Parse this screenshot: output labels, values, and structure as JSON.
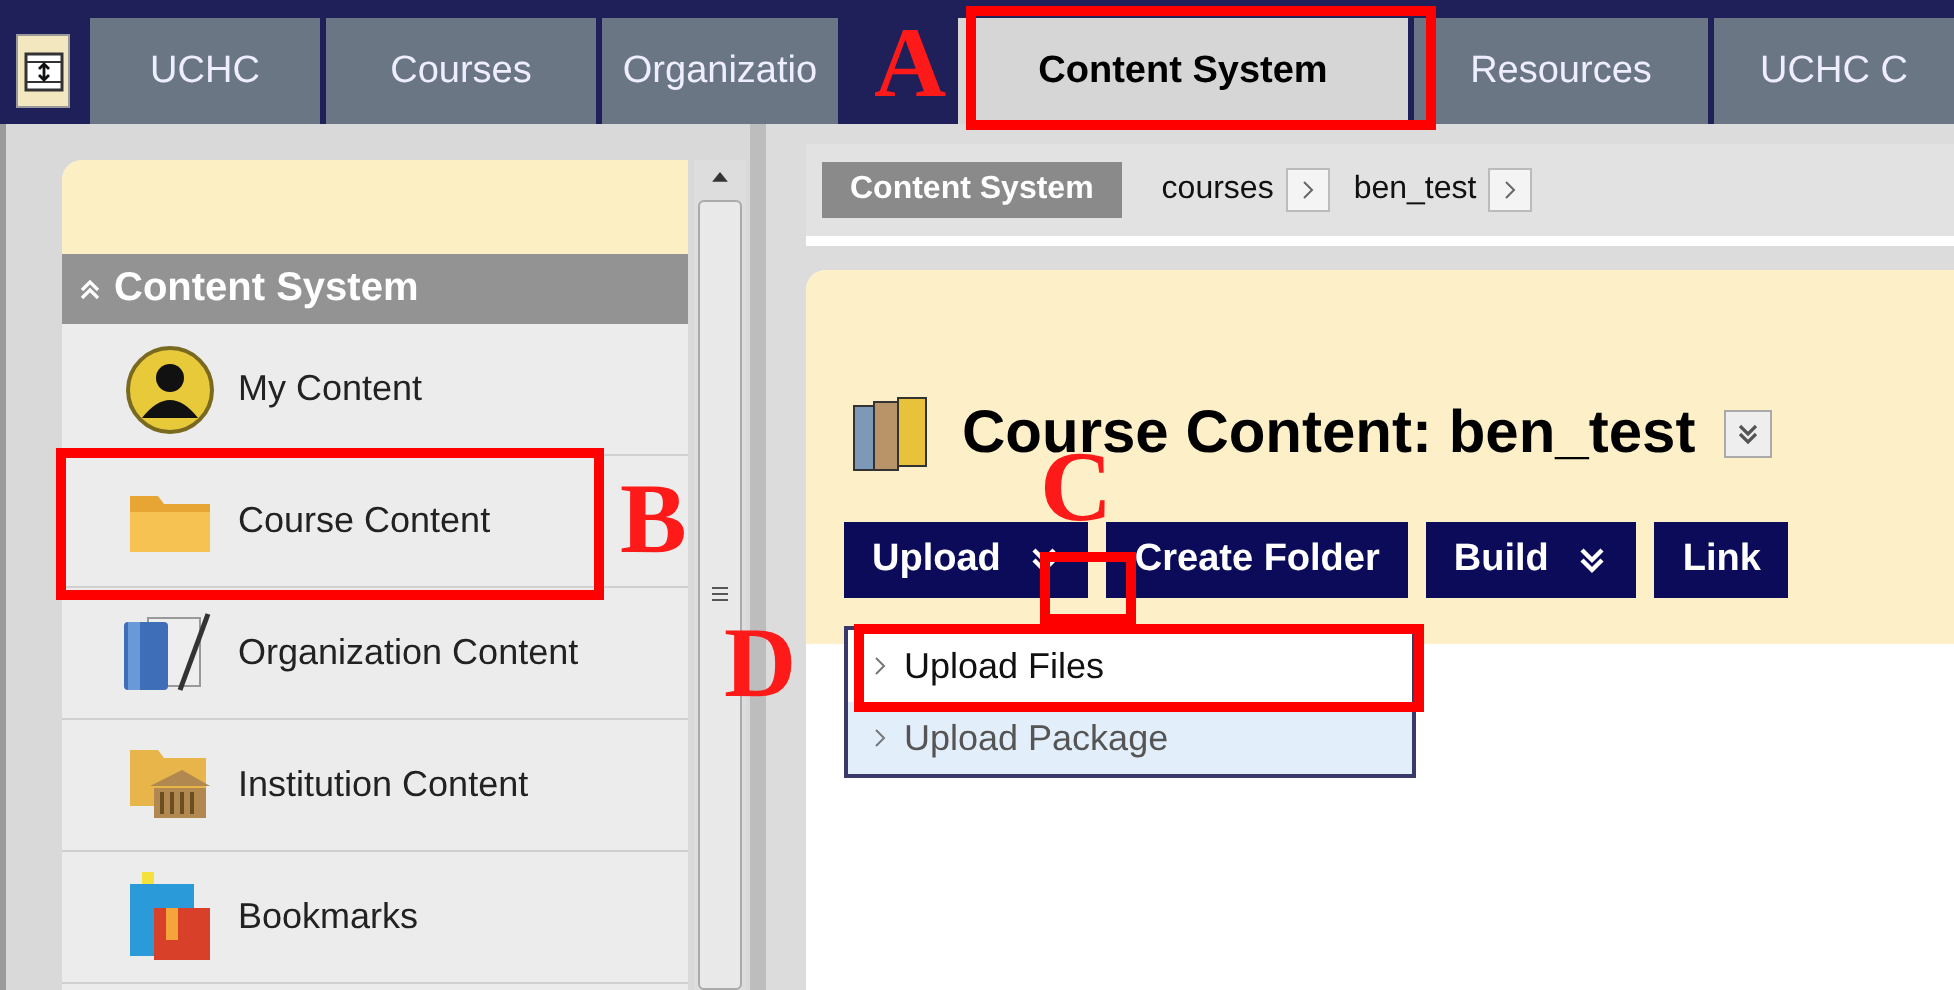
{
  "top_tabs": [
    {
      "label": "UCHC",
      "selected": false
    },
    {
      "label": "Courses",
      "selected": false
    },
    {
      "label": "Organizatio",
      "selected": false
    },
    {
      "label": "Content System",
      "selected": true
    },
    {
      "label": "Resources",
      "selected": false
    },
    {
      "label": "UCHC C",
      "selected": false
    }
  ],
  "sidebar": {
    "heading": "Content System",
    "items": [
      {
        "label": "My Content",
        "kind": "person"
      },
      {
        "label": "Course Content",
        "kind": "folder"
      },
      {
        "label": "Organization Content",
        "kind": "book"
      },
      {
        "label": "Institution Content",
        "kind": "institution"
      },
      {
        "label": "Bookmarks",
        "kind": "bookmarks"
      }
    ]
  },
  "breadcrumb": {
    "root": "Content System",
    "items": [
      "courses",
      "ben_test"
    ]
  },
  "page_title": "Course Content: ben_test",
  "toolbar": [
    {
      "label": "Upload",
      "menu": true
    },
    {
      "label": "Create Folder",
      "menu": false
    },
    {
      "label": "Build",
      "menu": true
    },
    {
      "label": "Link",
      "menu": false
    }
  ],
  "upload_menu": [
    {
      "label": "Upload Files",
      "selected": true
    },
    {
      "label": "Upload Package",
      "selected": false
    }
  ],
  "annotations": [
    {
      "label": "A"
    },
    {
      "label": "B"
    },
    {
      "label": "C"
    },
    {
      "label": "D"
    }
  ]
}
